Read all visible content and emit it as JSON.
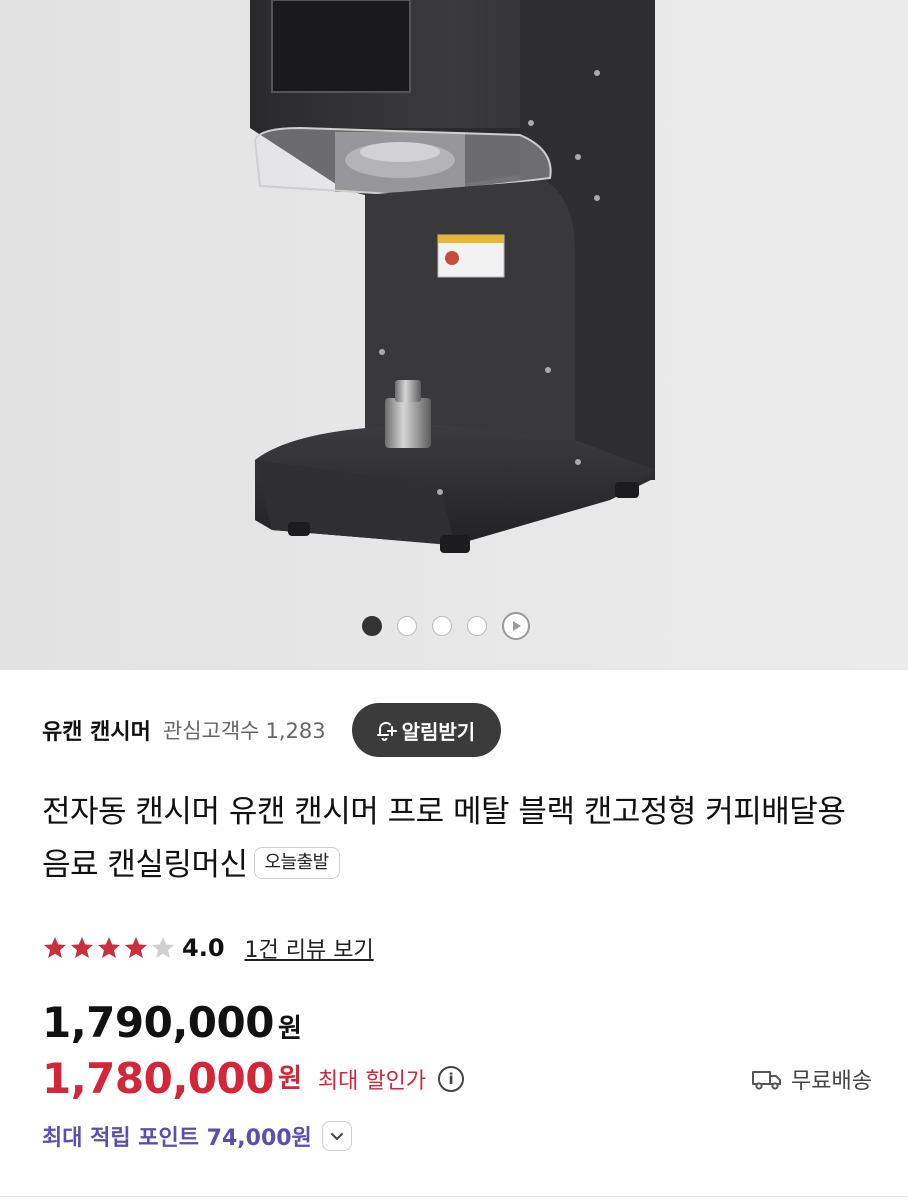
{
  "gallery": {
    "slide_count": 4,
    "active_index": 0
  },
  "store": {
    "name": "유캔 캔시머",
    "watchers_label": "관심고객수",
    "watchers_count": "1,283",
    "alarm_button": "알림받기"
  },
  "product": {
    "title": "전자동 캔시머 유캔 캔시머 프로 메탈 블랙 캔고정형 커피배달용 음료 캔실링머신",
    "badge": "오늘출발"
  },
  "rating": {
    "score": "4.0",
    "stars_filled": 4,
    "stars_total": 5,
    "review_link": "1건 리뷰 보기"
  },
  "price": {
    "original": "1,790,000",
    "original_unit": "원",
    "sale": "1,780,000",
    "sale_unit": "원",
    "discount_label": "최대 할인가",
    "shipping": "무료배송"
  },
  "points": {
    "label": "최대 적립 포인트 74,000원"
  },
  "colors": {
    "sale_red": "#d32639",
    "points_purple": "#5a4fb0",
    "star_red": "#c9303f",
    "button_dark": "#3b3b3b"
  }
}
